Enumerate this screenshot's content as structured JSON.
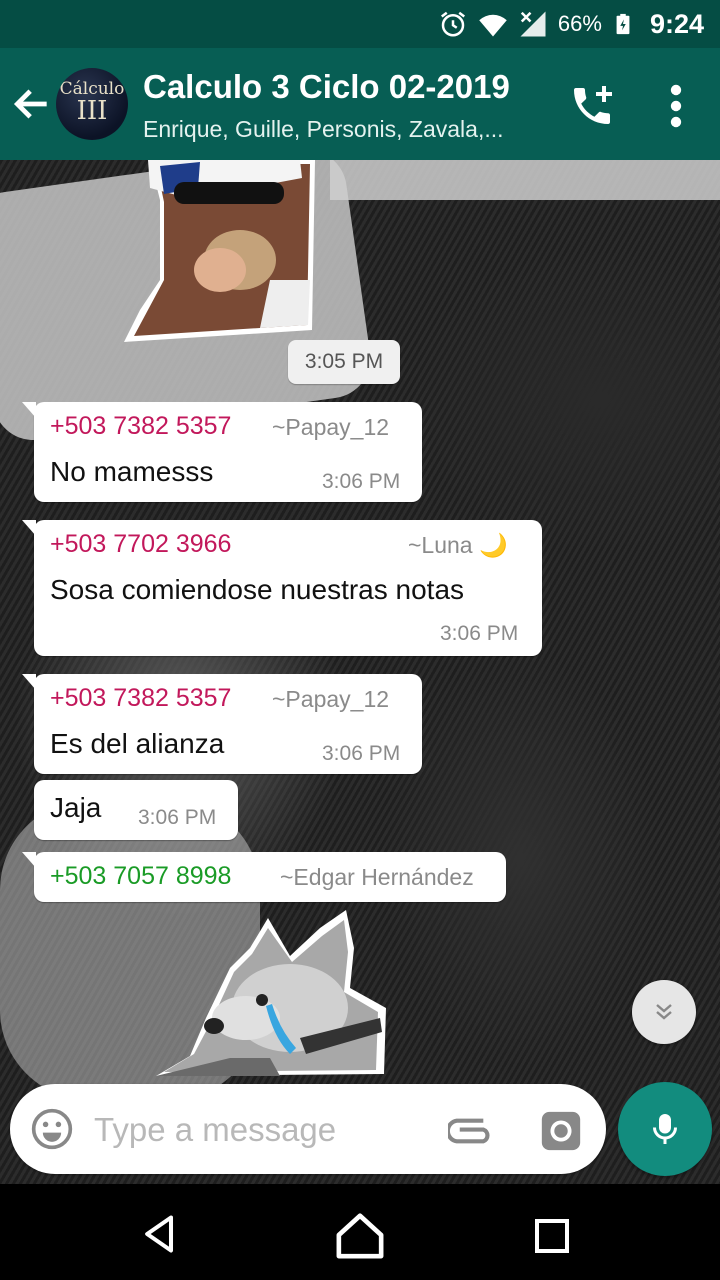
{
  "status_bar": {
    "battery_percent": "66%",
    "clock": "9:24",
    "icons": [
      "alarm-icon",
      "wifi-icon",
      "signal-icon",
      "battery-charging-icon"
    ]
  },
  "header": {
    "avatar_text_line1": "Cálculo",
    "avatar_text_line2": "III",
    "title": "Calculo 3 Ciclo 02-2019",
    "subtitle": "Enrique, Guille, Personis, Zavala,..."
  },
  "messages": {
    "sticker_time": "3:05 PM",
    "m1": {
      "sender": "+503 7382 5357",
      "alias": "~Papay_12",
      "text": "No mamesss",
      "time": "3:06 PM"
    },
    "m2": {
      "sender": "+503 7702 3966",
      "alias": "~Luna 🌙",
      "text": "Sosa comiendose nuestras notas",
      "time": "3:06 PM"
    },
    "m3": {
      "sender": "+503 7382 5357",
      "alias": "~Papay_12",
      "text": "Es del alianza",
      "time": "3:06 PM"
    },
    "m4": {
      "text": "Jaja",
      "time": "3:06 PM"
    },
    "m5": {
      "sender": "+503 7057 8998",
      "alias": "~Edgar Hernández"
    }
  },
  "composer": {
    "placeholder": "Type a message"
  },
  "colors": {
    "status_bar": "#054d44",
    "app_bar": "#075e54",
    "accent": "#128c7e",
    "sender_pink": "#c2185b",
    "sender_green": "#1a9b26"
  }
}
